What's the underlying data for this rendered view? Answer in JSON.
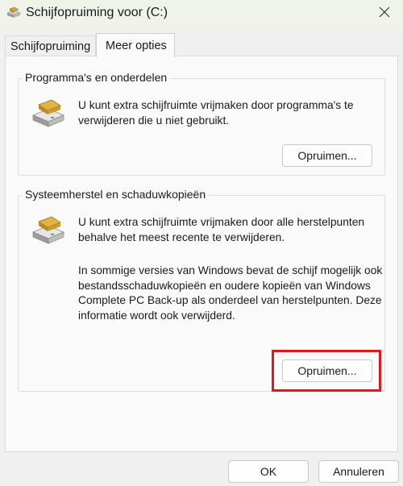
{
  "window": {
    "title": "Schijfopruiming voor  (C:)",
    "icon": "drive-cleanup-icon",
    "close_icon": "close-icon"
  },
  "tabs": [
    {
      "label": "Schijfopruiming",
      "selected": false
    },
    {
      "label": "Meer opties",
      "selected": true
    }
  ],
  "groups": {
    "programs": {
      "title": "Programma's en onderdelen",
      "description": "U kunt extra schijfruimte vrijmaken door programma's te verwijderen die u niet gebruikt.",
      "button_label": "Opruimen..."
    },
    "restore": {
      "title": "Systeemherstel en schaduwkopieën",
      "description": "U kunt extra schijfruimte vrijmaken door alle herstelpunten behalve het meest recente te verwijderen.",
      "info": "In sommige versies van Windows bevat de schijf mogelijk ook bestandsschaduwkopieën en oudere kopieën van Windows Complete PC Back-up als onderdeel van herstelpunten. Deze informatie wordt ook verwijderd.",
      "button_label": "Opruimen..."
    }
  },
  "footer": {
    "ok_label": "OK",
    "cancel_label": "Annuleren"
  },
  "colors": {
    "highlight": "#e8141a",
    "titlebar": "#f0f3ea"
  }
}
